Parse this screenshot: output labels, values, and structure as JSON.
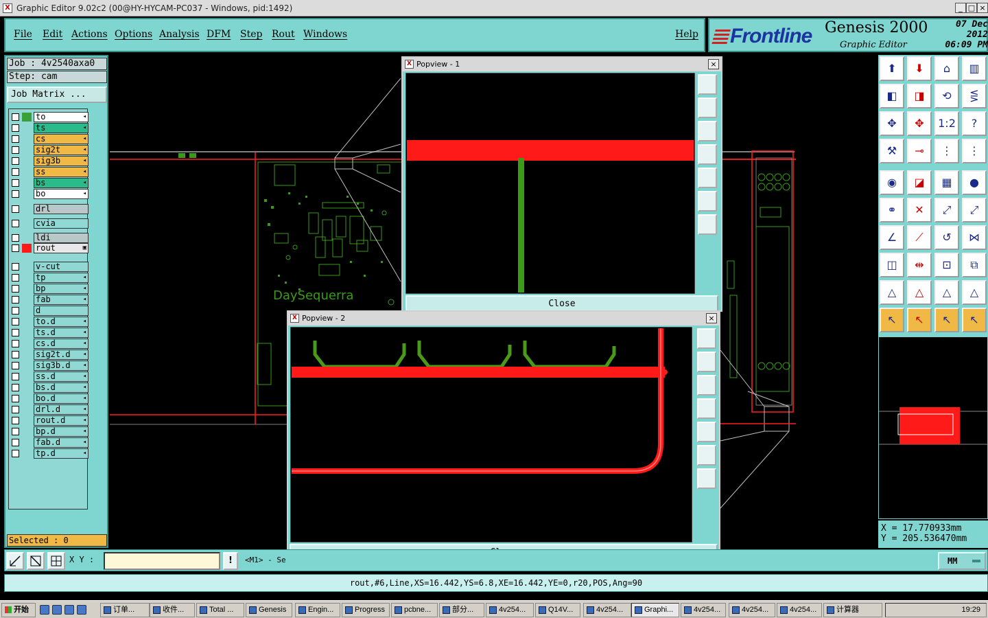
{
  "window": {
    "title": "Graphic Editor 9.02c2 (00@HY-HYCAM-PC037 - Windows, pid:1492)"
  },
  "menu": {
    "file": "File",
    "edit": "Edit",
    "actions": "Actions",
    "options": "Options",
    "analysis": "Analysis",
    "dfm": "DFM",
    "step": "Step",
    "rout": "Rout",
    "windows": "Windows",
    "help": "Help"
  },
  "brand": {
    "logo": "Frontline",
    "product": "Genesis 2000",
    "subtitle": "Graphic Editor",
    "date": "07 Dec 2012",
    "time": "06:09 PM"
  },
  "job": {
    "job_line": "Job : 4v2540axa0",
    "step_line": "Step: cam",
    "matrix_button": "Job Matrix ..."
  },
  "layers": [
    {
      "name": "to",
      "color": "#3aa03a",
      "bg": "#ffffff",
      "arrow": "◂"
    },
    {
      "name": "ts",
      "color": "#2bbb6a",
      "bg": "#2bbb8a",
      "arrow": "◂"
    },
    {
      "name": "cs",
      "color": "#f0b844",
      "bg": "#f0b844",
      "arrow": "◂"
    },
    {
      "name": "sig2t",
      "color": "#f0b844",
      "bg": "#f0b844",
      "arrow": "◂"
    },
    {
      "name": "sig3b",
      "color": "#f0b844",
      "bg": "#f0b844",
      "arrow": "◂"
    },
    {
      "name": "ss",
      "color": "#f0b844",
      "bg": "#f0b844",
      "arrow": "◂"
    },
    {
      "name": "bs",
      "color": "#2bbb8a",
      "bg": "#2bbb8a",
      "arrow": "◂"
    },
    {
      "name": "bo",
      "color": "#ffffff",
      "bg": "#ffffff",
      "arrow": "◂"
    },
    {
      "name": "drl",
      "color": "#b8c8c8",
      "bg": "#b8c8c8",
      "arrow": ""
    },
    {
      "name": "cvia",
      "color": "#8fd8d4",
      "bg": "#8fd8d4",
      "arrow": ""
    },
    {
      "name": "ldi",
      "color": "#b8c8c8",
      "bg": "#b8c8c8",
      "arrow": ""
    },
    {
      "name": "rout",
      "color": "#ff1a1a",
      "bg": "#e8e8e8",
      "arrow": "▣"
    },
    {
      "name": "v-cut",
      "color": "#8fd8d4",
      "bg": "#8fd8d4",
      "arrow": ""
    },
    {
      "name": "tp",
      "color": "#8fd8d4",
      "bg": "#8fd8d4",
      "arrow": "◂"
    },
    {
      "name": "bp",
      "color": "#8fd8d4",
      "bg": "#8fd8d4",
      "arrow": "◂"
    },
    {
      "name": "fab",
      "color": "#8fd8d4",
      "bg": "#8fd8d4",
      "arrow": "◂"
    },
    {
      "name": "d",
      "color": "#8fd8d4",
      "bg": "#8fd8d4",
      "arrow": ""
    },
    {
      "name": "to.d",
      "color": "#8fd8d4",
      "bg": "#8fd8d4",
      "arrow": "◂"
    },
    {
      "name": "ts.d",
      "color": "#8fd8d4",
      "bg": "#8fd8d4",
      "arrow": "◂"
    },
    {
      "name": "cs.d",
      "color": "#8fd8d4",
      "bg": "#8fd8d4",
      "arrow": "◂"
    },
    {
      "name": "sig2t.d",
      "color": "#8fd8d4",
      "bg": "#8fd8d4",
      "arrow": "◂"
    },
    {
      "name": "sig3b.d",
      "color": "#8fd8d4",
      "bg": "#8fd8d4",
      "arrow": "◂"
    },
    {
      "name": "ss.d",
      "color": "#8fd8d4",
      "bg": "#8fd8d4",
      "arrow": "◂"
    },
    {
      "name": "bs.d",
      "color": "#8fd8d4",
      "bg": "#8fd8d4",
      "arrow": "◂"
    },
    {
      "name": "bo.d",
      "color": "#8fd8d4",
      "bg": "#8fd8d4",
      "arrow": "◂"
    },
    {
      "name": "drl.d",
      "color": "#8fd8d4",
      "bg": "#8fd8d4",
      "arrow": "◂"
    },
    {
      "name": "rout.d",
      "color": "#8fd8d4",
      "bg": "#8fd8d4",
      "arrow": "◂"
    },
    {
      "name": "bp.d",
      "color": "#8fd8d4",
      "bg": "#8fd8d4",
      "arrow": "◂"
    },
    {
      "name": "fab.d",
      "color": "#8fd8d4",
      "bg": "#8fd8d4",
      "arrow": "◂"
    },
    {
      "name": "tp.d",
      "color": "#8fd8d4",
      "bg": "#8fd8d4",
      "arrow": "◂"
    }
  ],
  "selected": "Selected : 0",
  "canvas": {
    "board_text": "DaySequerra"
  },
  "popview1": {
    "title": "Popview - 1",
    "close": "Close"
  },
  "popview2": {
    "title": "Popview - 2",
    "close": "Close"
  },
  "coords": {
    "x": "X  =  17.770933mm",
    "y": "Y  = 205.536470mm"
  },
  "cmd": {
    "xy_label": "X Y :",
    "xy_value": "",
    "exclaim": "!",
    "prompt": "<M1> - Se",
    "units": "MM"
  },
  "status": "rout,#6,Line,XS=16.442,YS=6.8,XE=16.442,YE=0,r20,POS,Ang=90",
  "taskbar": {
    "start": "开始",
    "items": [
      "订单...",
      "收件...",
      "Total ...",
      "Genesis",
      "Engin...",
      "Progress",
      "pcbne...",
      "部分...",
      "4v254...",
      "Q14V...",
      "4v254...",
      "Graphi...",
      "4v254...",
      "4v254...",
      "4v254...",
      "计算器"
    ],
    "clock": "19:29"
  },
  "colors": {
    "panel": "#7fd6d0",
    "rout": "#ff1a1a",
    "trace": "#3a9a1a"
  }
}
